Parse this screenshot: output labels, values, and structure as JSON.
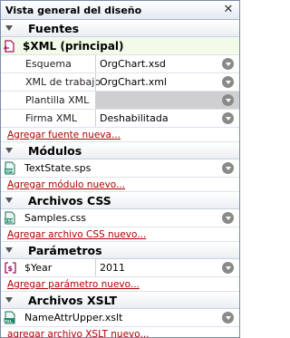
{
  "panel": {
    "title": "Vista general del diseño"
  },
  "sources": {
    "header": "Fuentes",
    "main_label": "$XML (principal)",
    "props": [
      {
        "label": "Esquema",
        "value": "OrgChart.xsd",
        "disabled": false
      },
      {
        "label": "XML de trabajo",
        "value": "OrgChart.xml",
        "disabled": false
      },
      {
        "label": "Plantilla XML",
        "value": "",
        "disabled": true
      },
      {
        "label": "Firma XML",
        "value": "Deshabilitada",
        "disabled": false
      }
    ],
    "add_link": "Agregar fuente nueva..."
  },
  "modules": {
    "header": "Módulos",
    "items": [
      {
        "name": "TextState.sps",
        "icon": "sps-file-icon"
      }
    ],
    "add_link": "Agregar módulo nuevo..."
  },
  "css": {
    "header": "Archivos CSS",
    "items": [
      {
        "name": "Samples.css",
        "icon": "css-file-icon"
      }
    ],
    "add_link": "Agregar archivo CSS nuevo..."
  },
  "params": {
    "header": "Parámetros",
    "items": [
      {
        "name": "$Year",
        "value": "2011",
        "icon": "parameter-icon"
      }
    ],
    "add_link": "Agregar parámetro nuevo..."
  },
  "xslt": {
    "header": "Archivos XSLT",
    "items": [
      {
        "name": "NameAttrUpper.xslt",
        "icon": "xslt-file-icon"
      }
    ],
    "add_link": "agregar archivo XSLT nuevo..."
  }
}
